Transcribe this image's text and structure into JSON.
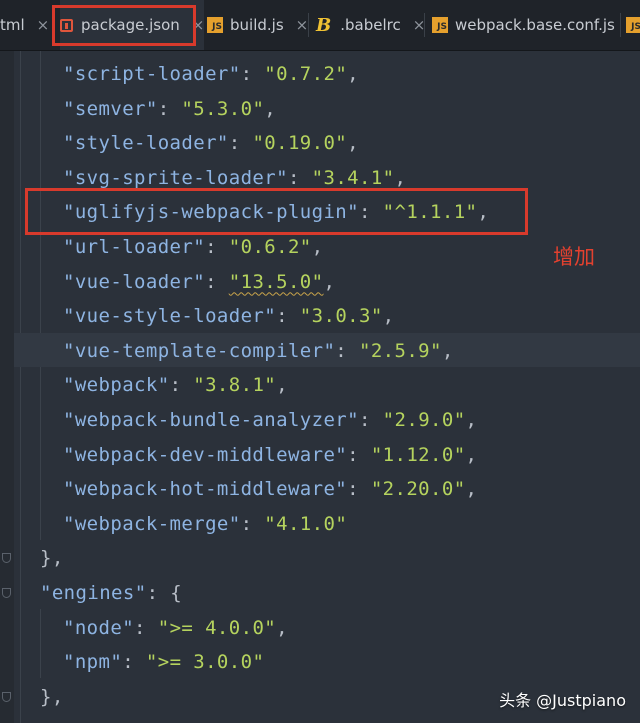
{
  "tabs": [
    {
      "label": "tml"
    },
    {
      "label": "package.json",
      "active": true
    },
    {
      "label": "build.js"
    },
    {
      "label": ".babelrc"
    },
    {
      "label": "webpack.base.conf.js"
    }
  ],
  "close_glyph": "×",
  "icon_text": {
    "js": "JS",
    "babel": "B"
  },
  "lines": [
    {
      "indent": 3,
      "key": "\"script-loader\"",
      "sep": ": ",
      "val": "\"0.7.2\"",
      "tail": ","
    },
    {
      "indent": 3,
      "key": "\"semver\"",
      "sep": ": ",
      "val": "\"5.3.0\"",
      "tail": ","
    },
    {
      "indent": 3,
      "key": "\"style-loader\"",
      "sep": ": ",
      "val": "\"0.19.0\"",
      "tail": ","
    },
    {
      "indent": 3,
      "key": "\"svg-sprite-loader\"",
      "sep": ": ",
      "val": "\"3.4.1\"",
      "tail": ","
    },
    {
      "indent": 3,
      "key": "\"uglifyjs-webpack-plugin\"",
      "sep": ": ",
      "val": "\"^1.1.1\"",
      "tail": ","
    },
    {
      "indent": 3,
      "key": "\"url-loader\"",
      "sep": ": ",
      "val": "\"0.6.2\"",
      "tail": ","
    },
    {
      "indent": 3,
      "key": "\"vue-loader\"",
      "sep": ": ",
      "val": "\"13.5.0\"",
      "tail": ",",
      "squiggle": true
    },
    {
      "indent": 3,
      "key": "\"vue-style-loader\"",
      "sep": ": ",
      "val": "\"3.0.3\"",
      "tail": ","
    },
    {
      "indent": 3,
      "key": "\"vue-template-compiler\"",
      "sep": ": ",
      "val": "\"2.5.9\"",
      "tail": ",",
      "highlight": true
    },
    {
      "indent": 3,
      "key": "\"webpack\"",
      "sep": ": ",
      "val": "\"3.8.1\"",
      "tail": ","
    },
    {
      "indent": 3,
      "key": "\"webpack-bundle-analyzer\"",
      "sep": ": ",
      "val": "\"2.9.0\"",
      "tail": ","
    },
    {
      "indent": 3,
      "key": "\"webpack-dev-middleware\"",
      "sep": ": ",
      "val": "\"1.12.0\"",
      "tail": ","
    },
    {
      "indent": 3,
      "key": "\"webpack-hot-middleware\"",
      "sep": ": ",
      "val": "\"2.20.0\"",
      "tail": ","
    },
    {
      "indent": 3,
      "key": "\"webpack-merge\"",
      "sep": ": ",
      "val": "\"4.1.0\"",
      "tail": ""
    },
    {
      "indent": 2,
      "key": "",
      "sep": "",
      "val": "",
      "tail": "},",
      "fold": true
    },
    {
      "indent": 2,
      "key": "\"engines\"",
      "sep": ": ",
      "val": "",
      "tail": "{",
      "fold": true
    },
    {
      "indent": 3,
      "key": "\"node\"",
      "sep": ": ",
      "val": "\">= 4.0.0\"",
      "tail": ","
    },
    {
      "indent": 3,
      "key": "\"npm\"",
      "sep": ": ",
      "val": "\">= 3.0.0\"",
      "tail": ""
    },
    {
      "indent": 2,
      "key": "",
      "sep": "",
      "val": "",
      "tail": "},",
      "fold": true
    }
  ],
  "annotation": {
    "text": "增加",
    "color": "#d83a2c"
  },
  "watermark": "头条 @Justpiano",
  "colors": {
    "key": "#8eb4e2",
    "value": "#b5d35e",
    "punct": "#b8bec7",
    "background": "#2b313a"
  }
}
